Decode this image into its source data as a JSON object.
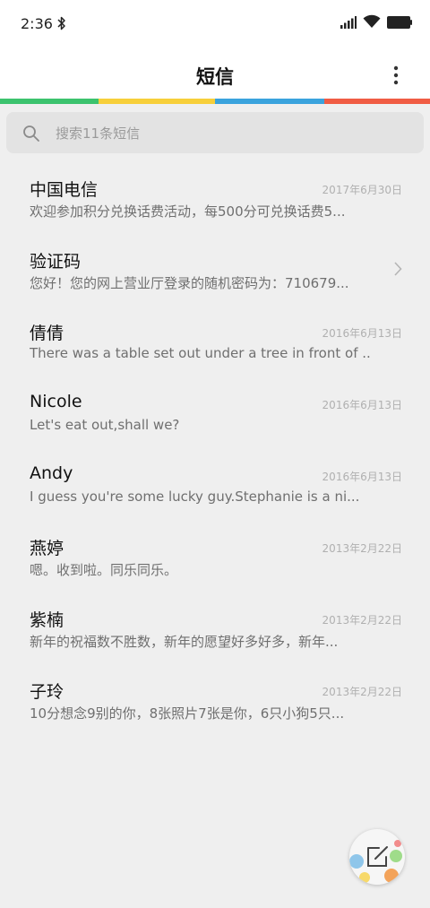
{
  "status": {
    "time": "2:36"
  },
  "header": {
    "title": "短信"
  },
  "accent_colors": [
    "#3cc36e",
    "#f7cf3a",
    "#3aa3dd",
    "#f05c44"
  ],
  "search": {
    "placeholder": "搜索11条短信"
  },
  "messages": [
    {
      "name": "中国电信",
      "date": "2017年6月30日",
      "preview": "欢迎参加积分兑换话费活动，每500分可兑换话费5..."
    },
    {
      "name": "验证码",
      "date": "",
      "preview": "您好！您的网上营业厅登录的随机密码为：710679..."
    },
    {
      "name": "倩倩",
      "date": "2016年6月13日",
      "preview": "There was a table set out under a tree in front of ..."
    },
    {
      "name": "Nicole",
      "date": "2016年6月13日",
      "preview": "Let's eat out,shall we?"
    },
    {
      "name": "Andy",
      "date": "2016年6月13日",
      "preview": "I guess you're some lucky guy.Stephanie is a ni..."
    },
    {
      "name": "燕婷",
      "date": "2013年2月22日",
      "preview": "嗯。收到啦。同乐同乐。"
    },
    {
      "name": "紫楠",
      "date": "2013年2月22日",
      "preview": "新年的祝福数不胜数，新年的愿望好多好多，新年..."
    },
    {
      "name": "子玲",
      "date": "2013年2月22日",
      "preview": "10分想念9别的你，8张照片7张是你，6只小狗5只..."
    }
  ]
}
